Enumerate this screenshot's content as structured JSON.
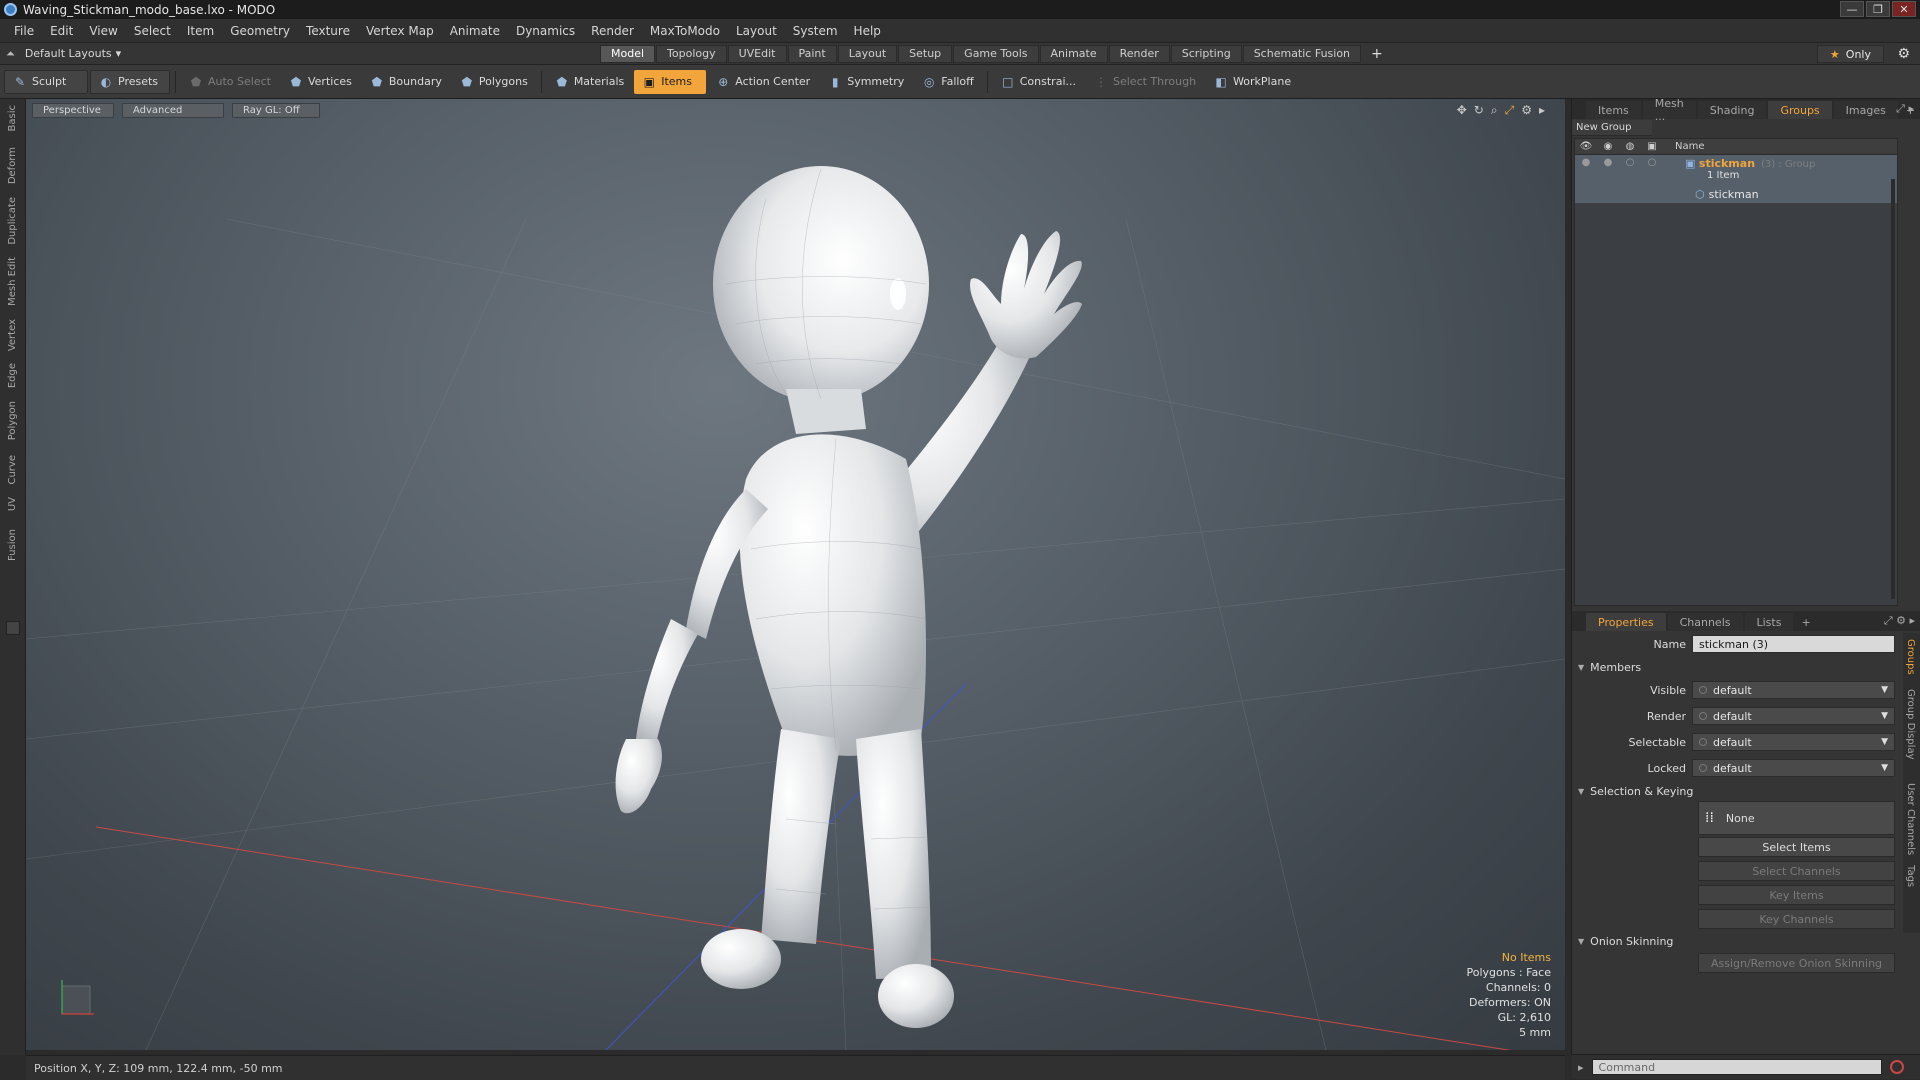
{
  "window": {
    "title": "Waving_Stickman_modo_base.lxo - MODO",
    "buttons": [
      "—",
      "❐",
      "✕"
    ]
  },
  "menu": [
    "File",
    "Edit",
    "View",
    "Select",
    "Item",
    "Geometry",
    "Texture",
    "Vertex Map",
    "Animate",
    "Dynamics",
    "Render",
    "MaxToModo",
    "Layout",
    "System",
    "Help"
  ],
  "layoutbar": {
    "layout_select": "Default Layouts",
    "tabs": [
      "Model",
      "Topology",
      "UVEdit",
      "Paint",
      "Layout",
      "Setup",
      "Game Tools",
      "Animate",
      "Render",
      "Scripting",
      "Schematic Fusion"
    ],
    "active_tab": "Model",
    "only_label": "Only"
  },
  "toolbar": {
    "sculpt": "Sculpt",
    "presets": "Presets",
    "auto_select": "Auto Select",
    "vertices": "Vertices",
    "boundary": "Boundary",
    "polygons": "Polygons",
    "materials": "Materials",
    "items": "Items",
    "action_center": "Action Center",
    "symmetry": "Symmetry",
    "falloff": "Falloff",
    "constraints": "Constrai...",
    "select_through": "Select Through",
    "workplane": "WorkPlane"
  },
  "left_palette": [
    "Basic",
    "Deform",
    "Duplicate",
    "Mesh Edit",
    "Vertex",
    "Edge",
    "Polygon",
    "Curve",
    "UV",
    "Fusion"
  ],
  "viewport": {
    "view": "Perspective",
    "advanced": "Advanced",
    "raygl": "Ray GL: Off",
    "info": {
      "items": "No Items",
      "polygons": "Polygons : Face",
      "channels": "Channels: 0",
      "deformers": "Deformers: ON",
      "gl": "GL: 2,610",
      "scale": "5 mm"
    }
  },
  "status": {
    "position": "Position X, Y, Z:  109 mm, 122.4 mm, -50 mm"
  },
  "top_panel": {
    "tabs": [
      "Items",
      "Mesh ...",
      "Shading",
      "Groups",
      "Images"
    ],
    "active_tab": "Groups",
    "new_group": "New Group",
    "tree_header": "Name",
    "group_name": "stickman",
    "group_meta": "(3) : Group",
    "group_count": "1 Item",
    "child_name": "stickman"
  },
  "properties": {
    "tabs": [
      "Properties",
      "Channels",
      "Lists"
    ],
    "active_tab": "Properties",
    "name_label": "Name",
    "name_value": "stickman (3)",
    "members_section": "Members",
    "visible_label": "Visible",
    "visible_value": "default",
    "render_label": "Render",
    "render_value": "default",
    "selectable_label": "Selectable",
    "selectable_value": "default",
    "locked_label": "Locked",
    "locked_value": "default",
    "selkey_section": "Selection & Keying",
    "none_label": "None",
    "select_items": "Select Items",
    "select_channels": "Select Channels",
    "key_items": "Key Items",
    "key_channels": "Key Channels",
    "onion_section": "Onion Skinning",
    "onion_button": "Assign/Remove Onion Skinning",
    "side_tabs": [
      "Groups",
      "Group Display",
      "User Channels",
      "Tags"
    ]
  },
  "command": {
    "placeholder": "Command"
  },
  "colors": {
    "accent": "#f2a53a",
    "viewport_top": "#6e7780",
    "viewport_bottom": "#353b41"
  }
}
